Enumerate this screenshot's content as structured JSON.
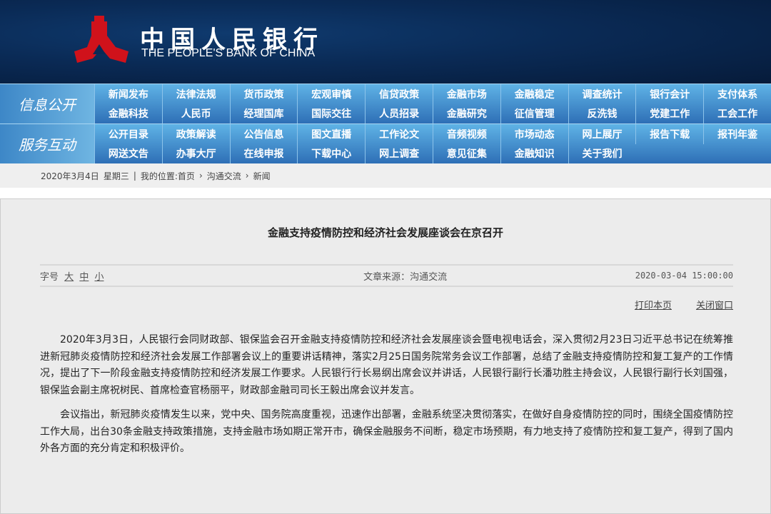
{
  "header": {
    "logo_cn": "中国人民银行",
    "logo_en": "THE PEOPLE'S BANK OF CHINA",
    "logo_color": "#d0121b"
  },
  "nav": [
    {
      "label": "信息公开",
      "items": [
        "新闻发布",
        "法律法规",
        "货币政策",
        "宏观审慎",
        "信贷政策",
        "金融市场",
        "金融稳定",
        "调查统计",
        "银行会计",
        "支付体系",
        "金融科技",
        "人民币",
        "经理国库",
        "国际交往",
        "人员招录",
        "金融研究",
        "征信管理",
        "反洗钱",
        "党建工作",
        "工会工作"
      ]
    },
    {
      "label": "服务互动",
      "items": [
        "公开目录",
        "政策解读",
        "公告信息",
        "图文直播",
        "工作论文",
        "音频视频",
        "市场动态",
        "网上展厅",
        "报告下载",
        "报刊年鉴",
        "网送文告",
        "办事大厅",
        "在线申报",
        "下载中心",
        "网上调查",
        "意见征集",
        "金融知识",
        "关于我们"
      ]
    }
  ],
  "breadcrumb": {
    "date": "2020年3月4日",
    "weekday": "星期三",
    "sep": "|",
    "prefix": "我的位置:",
    "items": [
      "首页",
      "沟通交流",
      "新闻"
    ]
  },
  "article": {
    "title": "金融支持疫情防控和经济社会发展座谈会在京召开",
    "font_label": "字号",
    "font_sizes": [
      "大",
      "中",
      "小"
    ],
    "source": "文章来源：沟通交流",
    "datetime": "2020-03-04 15:00:00",
    "print": "打印本页",
    "close": "关闭窗口",
    "paragraphs": [
      "2020年3月3日，人民银行会同财政部、银保监会召开金融支持疫情防控和经济社会发展座谈会暨电视电话会，深入贯彻2月23日习近平总书记在统筹推进新冠肺炎疫情防控和经济社会发展工作部署会议上的重要讲话精神，落实2月25日国务院常务会议工作部署，总结了金融支持疫情防控和复工复产的工作情况，提出了下一阶段金融支持疫情防控和经济发展工作要求。人民银行行长易纲出席会议并讲话，人民银行副行长潘功胜主持会议，人民银行副行长刘国强，银保监会副主席祝树民、首席检查官杨丽平，财政部金融司司长王毅出席会议并发言。",
      "会议指出，新冠肺炎疫情发生以来，党中央、国务院高度重视，迅速作出部署，金融系统坚决贯彻落实，在做好自身疫情防控的同时，围绕全国疫情防控工作大局，出台30条金融支持政策措施，支持金融市场如期正常开市，确保金融服务不间断，稳定市场预期，有力地支持了疫情防控和复工复产，得到了国内外各方面的充分肯定和积极评价。"
    ]
  }
}
